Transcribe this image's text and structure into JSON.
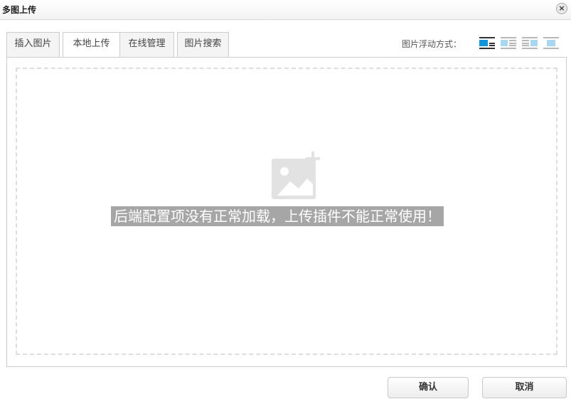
{
  "dialog": {
    "title": "多图上传",
    "close_glyph": "×"
  },
  "tabs": [
    {
      "label": "插入图片",
      "active": false
    },
    {
      "label": "本地上传",
      "active": true
    },
    {
      "label": "在线管理",
      "active": false
    },
    {
      "label": "图片搜索",
      "active": false
    }
  ],
  "float": {
    "label": "图片浮动方式：",
    "options": [
      "float-none-icon",
      "float-left-icon",
      "float-center-icon",
      "float-right-icon"
    ],
    "selected_color": "#1296db"
  },
  "upload": {
    "icon": "image-add-icon",
    "error_message": "后端配置项没有正常加载，上传插件不能正常使用！"
  },
  "buttons": {
    "confirm": "确认",
    "cancel": "取消"
  }
}
